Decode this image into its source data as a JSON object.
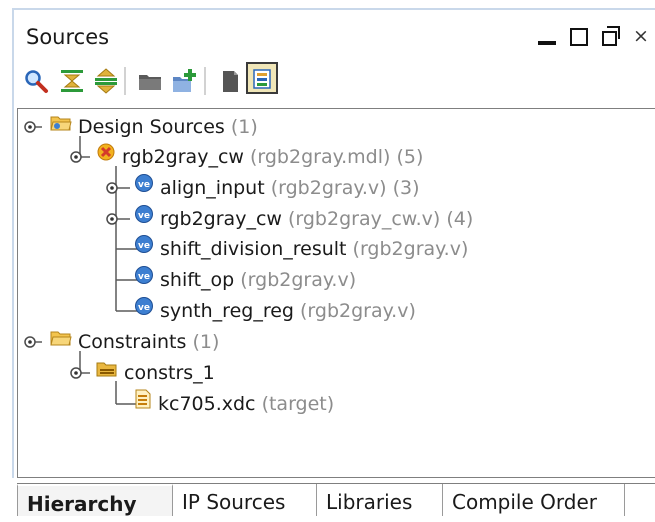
{
  "panel": {
    "title": "Sources"
  },
  "window_controls": [
    "minimize-icon",
    "maximize-icon",
    "restore-icon",
    "close-icon"
  ],
  "close_glyph": "×",
  "toolbar": {
    "items": [
      "search-icon",
      "collapse-all-icon",
      "expand-all-icon",
      "open-folder-icon",
      "add-sources-icon",
      "document-icon",
      "show-hierarchy-icon"
    ]
  },
  "tree": {
    "design_sources": {
      "label": "Design Sources",
      "count": "(1)"
    },
    "rgb2gray_cw_top": {
      "label": "rgb2gray_cw",
      "detail": "(rgb2gray.mdl) (5)"
    },
    "align_input": {
      "label": "align_input",
      "detail": "(rgb2gray.v) (3)"
    },
    "rgb2gray_cw_child": {
      "label": "rgb2gray_cw",
      "detail": "(rgb2gray_cw.v) (4)"
    },
    "shift_division_result": {
      "label": "shift_division_result",
      "detail": "(rgb2gray.v)"
    },
    "shift_op": {
      "label": "shift_op",
      "detail": "(rgb2gray.v)"
    },
    "synth_reg_reg": {
      "label": "synth_reg_reg",
      "detail": "(rgb2gray.v)"
    },
    "constraints": {
      "label": "Constraints",
      "count": "(1)"
    },
    "constrs_1": {
      "label": "constrs_1"
    },
    "kc705": {
      "label": "kc705.xdc",
      "detail": "(target)"
    }
  },
  "tabs": [
    {
      "label": "Hierarchy",
      "active": true
    },
    {
      "label": "IP Sources",
      "active": false
    },
    {
      "label": "Libraries",
      "active": false
    },
    {
      "label": "Compile Order",
      "active": false
    }
  ],
  "colors": {
    "folder": "#e5a52a",
    "verilog_badge": "#3d7fd1",
    "error_badge": "#d43a2a",
    "meta_text": "#8c8c8c"
  }
}
